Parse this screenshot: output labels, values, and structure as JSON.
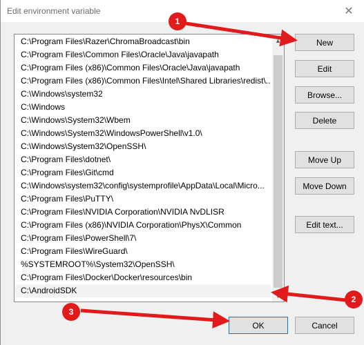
{
  "window": {
    "title": "Edit environment variable",
    "close_glyph": "✕"
  },
  "paths": [
    "C:\\Program Files\\Razer\\ChromaBroadcast\\bin",
    "C:\\Program Files\\Common Files\\Oracle\\Java\\javapath",
    "C:\\Program Files (x86)\\Common Files\\Oracle\\Java\\javapath",
    "C:\\Program Files (x86)\\Common Files\\Intel\\Shared Libraries\\redist\\...",
    "C:\\Windows\\system32",
    "C:\\Windows",
    "C:\\Windows\\System32\\Wbem",
    "C:\\Windows\\System32\\WindowsPowerShell\\v1.0\\",
    "C:\\Windows\\System32\\OpenSSH\\",
    "C:\\Program Files\\dotnet\\",
    "C:\\Program Files\\Git\\cmd",
    "C:\\Windows\\system32\\config\\systemprofile\\AppData\\Local\\Micro...",
    "C:\\Program Files\\PuTTY\\",
    "C:\\Program Files\\NVIDIA Corporation\\NVIDIA NvDLISR",
    "C:\\Program Files (x86)\\NVIDIA Corporation\\PhysX\\Common",
    "C:\\Program Files\\PowerShell\\7\\",
    "C:\\Program Files\\WireGuard\\",
    "%SYSTEMROOT%\\System32\\OpenSSH\\",
    "C:\\Program Files\\Docker\\Docker\\resources\\bin",
    "C:\\AndroidSDK"
  ],
  "buttons": {
    "new": "New",
    "edit": "Edit",
    "browse": "Browse...",
    "delete": "Delete",
    "move_up": "Move Up",
    "move_down": "Move Down",
    "edit_text": "Edit text...",
    "ok": "OK",
    "cancel": "Cancel"
  },
  "annotations": {
    "c1": "1",
    "c2": "2",
    "c3": "3",
    "color": "#e11b1b"
  }
}
